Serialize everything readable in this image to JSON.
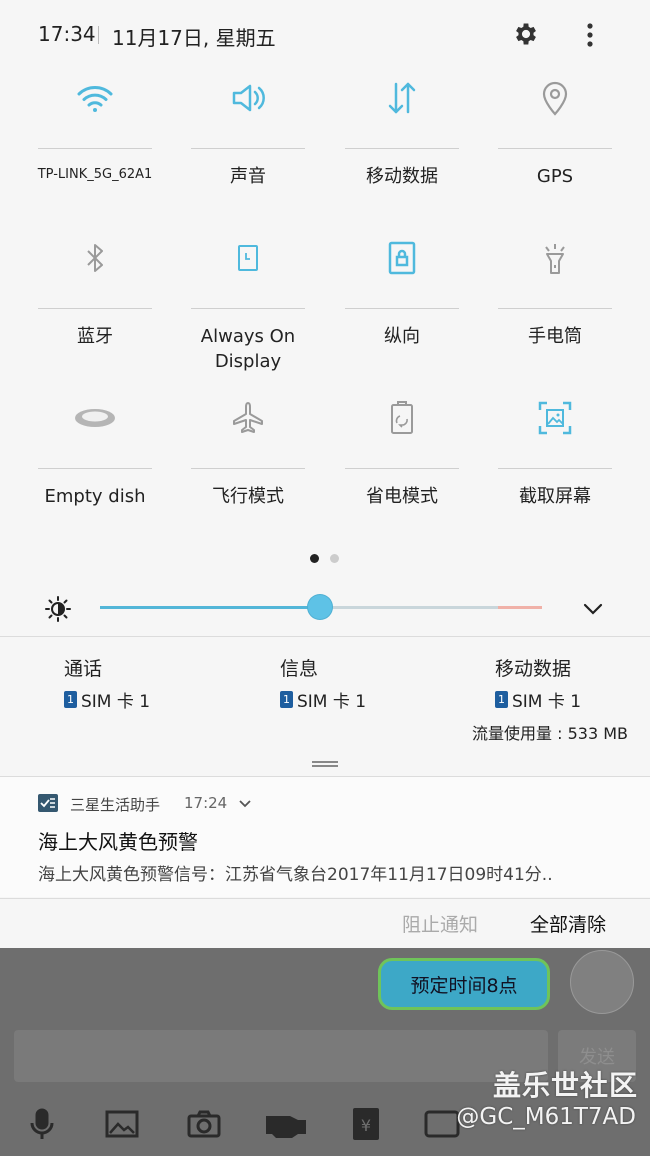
{
  "status": {
    "time": "17:34",
    "date": "11月17日, 星期五"
  },
  "icons": {
    "settings": "gear-icon",
    "more": "more-vert-icon"
  },
  "colors": {
    "accent": "#4fb9dd",
    "tile_inactive": "#9a9a9a",
    "sim_badge": "#1e5e9f"
  },
  "tiles": [
    {
      "label": "TP-LINK_5G_62A1",
      "icon": "wifi-icon",
      "active": true
    },
    {
      "label": "声音",
      "icon": "speaker-icon",
      "active": true
    },
    {
      "label": "移动数据",
      "icon": "mobile-data-icon",
      "active": true
    },
    {
      "label": "GPS",
      "icon": "location-pin-icon",
      "active": false
    },
    {
      "label": "蓝牙",
      "icon": "bluetooth-icon",
      "active": false
    },
    {
      "label": "Always On Display",
      "icon": "always-on-display-icon",
      "active": true
    },
    {
      "label": "纵向",
      "icon": "portrait-lock-icon",
      "active": true
    },
    {
      "label": "手电筒",
      "icon": "flashlight-icon",
      "active": false
    },
    {
      "label": "Empty dish",
      "icon": "dish-icon",
      "active": false
    },
    {
      "label": "飞行模式",
      "icon": "airplane-icon",
      "active": false
    },
    {
      "label": "省电模式",
      "icon": "battery-saver-icon",
      "active": false
    },
    {
      "label": "截取屏幕",
      "icon": "screenshot-icon",
      "active": true
    }
  ],
  "page_indicator": {
    "current": 1,
    "total": 2
  },
  "brightness": {
    "level": 0.5
  },
  "sim": {
    "calls": {
      "title": "通话",
      "value": "SIM 卡 1",
      "badge": "1"
    },
    "messages": {
      "title": "信息",
      "value": "SIM 卡 1",
      "badge": "1"
    },
    "data": {
      "title": "移动数据",
      "value": "SIM 卡 1",
      "badge": "1"
    },
    "usage": "流量使用量 : 533 MB"
  },
  "notification": {
    "app": "三星生活助手",
    "time": "17:24",
    "title": "海上大风黄色预警",
    "body": "海上大风黄色预警信号：江苏省气象台2017年11月17日09时41分..",
    "block_label": "阻止通知",
    "clear_label": "全部清除"
  },
  "background_app": {
    "bubble_text": "预定时间8点",
    "send_label": "发送",
    "watermark_site": "盖乐世社区",
    "watermark_user": "@GC_M61T7AD"
  }
}
